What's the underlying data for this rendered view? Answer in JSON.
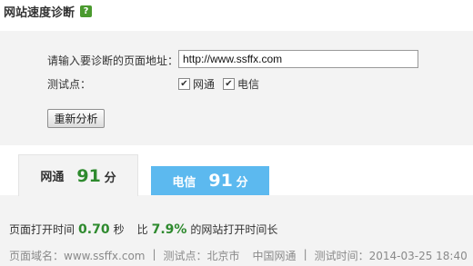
{
  "header": {
    "title": "网站速度诊断",
    "help_glyph": "?"
  },
  "form": {
    "url_label": "请输入要诊断的页面地址：",
    "url_value": "http://www.ssffx.com",
    "test_point_label": "测试点：",
    "checkboxes": [
      {
        "label": "网通",
        "checked": true
      },
      {
        "label": "电信",
        "checked": true
      }
    ],
    "analyze_button": "重新分析"
  },
  "tabs": [
    {
      "name": "网通",
      "score": "91",
      "unit": "分",
      "active": true
    },
    {
      "name": "电信",
      "score": "91",
      "unit": "分",
      "active": false
    }
  ],
  "summary": {
    "prefix": "页面打开时间",
    "time_value": "0.70",
    "time_unit": "秒",
    "compare_prefix": "比",
    "percent": "7.9%",
    "compare_suffix": "的网站打开时间长"
  },
  "meta": {
    "domain": "页面域名：www.ssffx.com",
    "test_point": "测试点：北京市",
    "network": "中国网通",
    "test_time": "测试时间：2014-03-25 18:40",
    "separator": "|"
  },
  "colors": {
    "accent_green": "#2e8a2e",
    "telecom_blue": "#5cb9ef",
    "panel_bg": "#f3f3f3"
  }
}
